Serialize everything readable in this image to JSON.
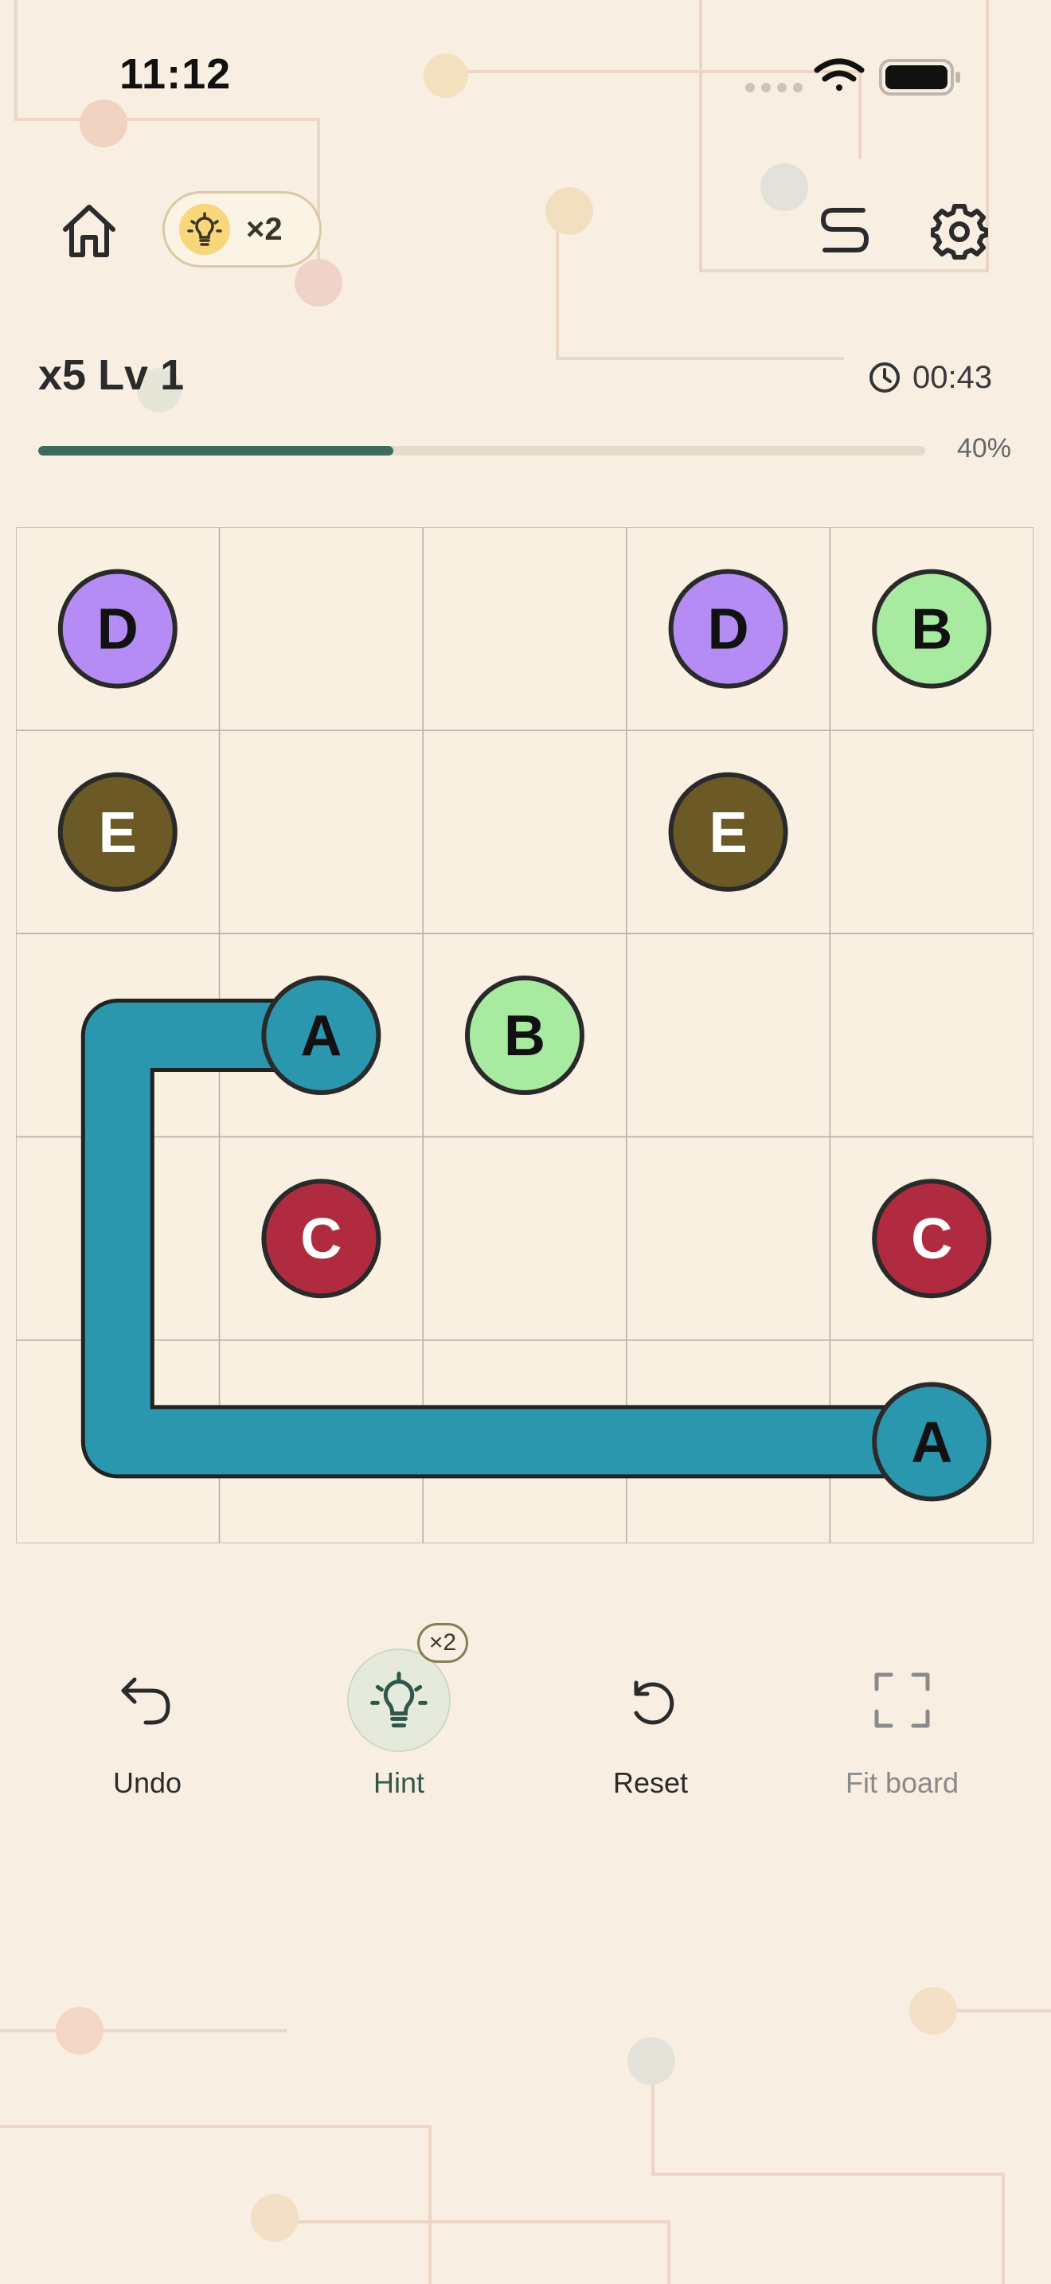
{
  "status_bar": {
    "time": "11:12"
  },
  "top_bar": {
    "hint_count": "×2"
  },
  "level": {
    "title": "x5 Lv 1",
    "timer": "00:43",
    "progress": 0.4,
    "progress_label": "40%"
  },
  "board": {
    "rows": 5,
    "cols": 5,
    "colors": {
      "A": "#2b97ae",
      "B": "#a8eaa0",
      "C": "#b02b40",
      "D": "#b48cf4",
      "E": "#6b5a26"
    },
    "text_colors": {
      "A": "#111111",
      "B": "#111111",
      "C": "#ffffff",
      "D": "#111111",
      "E": "#ffffff"
    },
    "dots": [
      {
        "label": "D",
        "row": 0,
        "col": 0
      },
      {
        "label": "D",
        "row": 0,
        "col": 3
      },
      {
        "label": "B",
        "row": 0,
        "col": 4
      },
      {
        "label": "E",
        "row": 1,
        "col": 0
      },
      {
        "label": "E",
        "row": 1,
        "col": 3
      },
      {
        "label": "A",
        "row": 2,
        "col": 1
      },
      {
        "label": "B",
        "row": 2,
        "col": 2
      },
      {
        "label": "C",
        "row": 3,
        "col": 1
      },
      {
        "label": "C",
        "row": 3,
        "col": 4
      },
      {
        "label": "A",
        "row": 4,
        "col": 4
      }
    ],
    "paths": [
      {
        "label": "A",
        "cells": [
          [
            2,
            1
          ],
          [
            2,
            0
          ],
          [
            3,
            0
          ],
          [
            4,
            0
          ],
          [
            4,
            1
          ],
          [
            4,
            2
          ],
          [
            4,
            3
          ],
          [
            4,
            4
          ]
        ]
      }
    ]
  },
  "toolbar": {
    "undo": "Undo",
    "hint": "Hint",
    "hint_badge": "×2",
    "reset": "Reset",
    "fit": "Fit board"
  }
}
